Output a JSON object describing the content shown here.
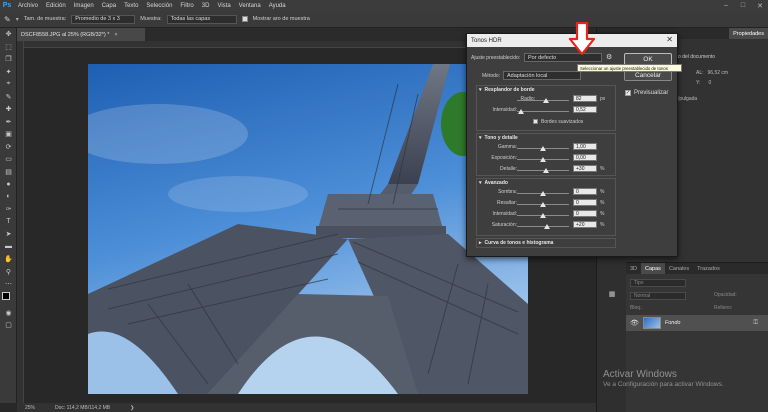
{
  "menu": {
    "logo": "Ps",
    "items": [
      "Archivo",
      "Edición",
      "Imagen",
      "Capa",
      "Texto",
      "Selección",
      "Filtro",
      "3D",
      "Vista",
      "Ventana",
      "Ayuda"
    ]
  },
  "options_bar": {
    "sample_size_label": "Tam. de muestra:",
    "sample_size_value": "Promedio de 3 x 3",
    "sample_label": "Muestra:",
    "sample_value": "Todas las capas",
    "show_ring_label": "Mostrar aro de muestra"
  },
  "document": {
    "tab_title": "DSCF8558.JPG al 25% (RGB/32*) *",
    "zoom": "25%",
    "doc_info": "Doc: 114,2 MB/114,2 MB"
  },
  "right_panel": {
    "tab_properties": "Propiedades",
    "doc_props": "o del documento",
    "al_label": "AL:",
    "al_value": "96,52 cm",
    "y_label": "Y:",
    "y_value": "0",
    "resolution": "/pulgada",
    "layer_tabs": [
      "3D",
      "Capas",
      "Canales",
      "Trazados"
    ],
    "search_placeholder": "Tipo",
    "blend_mode": "Normal",
    "opacity_label": "Opacidad:",
    "lock_label": "Bloq.:",
    "fill_label": "Relleno:",
    "layer_name": "Fondo"
  },
  "watermark": {
    "line1": "Activar Windows",
    "line2": "Ve a Configuración para activar Windows."
  },
  "dialog": {
    "title": "Tonos HDR",
    "preset_label": "Ajuste preestablecido:",
    "preset_value": "Por defecto",
    "ok": "OK",
    "cancel": "Cancelar",
    "preview_label": "Previsualizar",
    "method_label": "Método:",
    "method_value": "Adaptación local",
    "tooltip": "Seleccionar un ajuste preestablecido de tonos",
    "edge_glow": {
      "title": "Resplandor de borde",
      "radius_label": "Radio:",
      "radius_value": "82",
      "radius_unit": "px",
      "radius_level": 0.55,
      "strength_label": "Intensidad:",
      "strength_value": "0,52",
      "strength_level": 0.08,
      "smooth_edges_label": "Bordes suavizados"
    },
    "tone_detail": {
      "title": "Tono y detalle",
      "gamma_label": "Gamma:",
      "gamma_value": "1,00",
      "gamma_level": 0.5,
      "exposure_label": "Exposición:",
      "exposure_value": "0,00",
      "exposure_level": 0.5,
      "detail_label": "Detalle:",
      "detail_value": "+30",
      "detail_unit": "%",
      "detail_level": 0.56
    },
    "advanced": {
      "title": "Avanzado",
      "shadow_label": "Sombra:",
      "shadow_value": "0",
      "shadow_level": 0.5,
      "highlight_label": "Resaltar:",
      "highlight_value": "0",
      "highlight_level": 0.5,
      "vibrance_label": "Intensidad:",
      "vibrance_value": "0",
      "vibrance_level": 0.5,
      "saturation_label": "Saturación:",
      "saturation_value": "+20",
      "saturation_level": 0.58,
      "unit": "%"
    },
    "curve_label": "Curva de tonos e histograma"
  },
  "colors": {
    "accent_blue": "#31a8ff",
    "arrow_red": "#e8241c"
  }
}
